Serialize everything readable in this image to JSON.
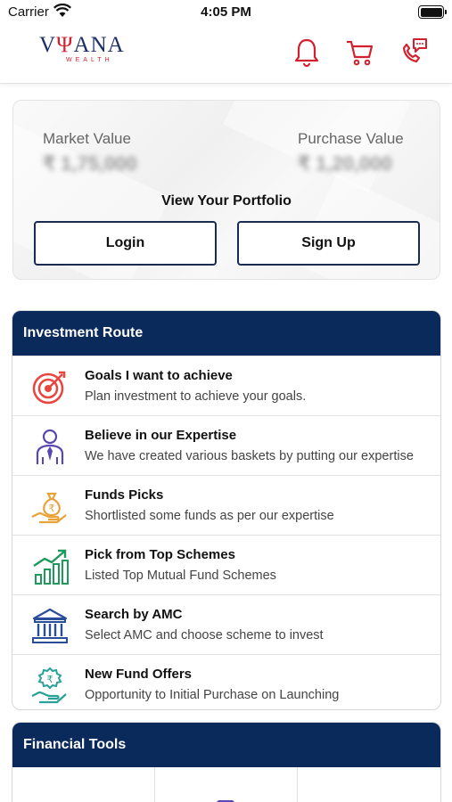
{
  "status_bar": {
    "carrier": "Carrier",
    "time": "4:05 PM"
  },
  "header": {
    "logo": {
      "part1": "V",
      "part2": "Ψ",
      "part3": "ANA",
      "sub": "WEALTH"
    },
    "icons": [
      "bell-icon",
      "cart-icon",
      "phone-chat-icon"
    ],
    "accent_color": "#d3202e"
  },
  "portfolio": {
    "market_label": "Market Value",
    "market_value": "₹ 1,75,000",
    "purchase_label": "Purchase Value",
    "purchase_value": "₹ 1,20,000",
    "view_title": "View Your Portfolio",
    "login_label": "Login",
    "signup_label": "Sign Up"
  },
  "investment_route": {
    "title": "Investment Route",
    "header_color": "#0a2a5c",
    "items": [
      {
        "icon": "target-icon",
        "title": "Goals I want to achieve",
        "desc": "Plan investment to achieve your goals."
      },
      {
        "icon": "expert-icon",
        "title": "Believe in our Expertise",
        "desc": "We have created various baskets by putting our expertise"
      },
      {
        "icon": "money-bag-icon",
        "title": "Funds Picks",
        "desc": "Shortlisted some funds as per our expertise"
      },
      {
        "icon": "growth-chart-icon",
        "title": "Pick from Top Schemes",
        "desc": "Listed Top Mutual Fund Schemes"
      },
      {
        "icon": "bank-icon",
        "title": "Search by AMC",
        "desc": "Select AMC and choose scheme to invest"
      },
      {
        "icon": "rupee-hand-icon",
        "title": "New Fund Offers",
        "desc": "Opportunity to Initial Purchase on Launching"
      }
    ]
  },
  "financial_tools": {
    "title": "Financial Tools"
  }
}
